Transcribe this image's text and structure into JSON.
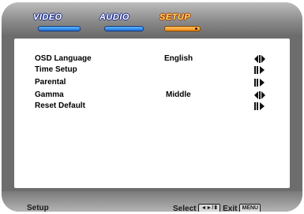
{
  "tabs": [
    {
      "label": "VIDEO",
      "active": false
    },
    {
      "label": "AUDIO",
      "active": false
    },
    {
      "label": "SETUP",
      "active": true
    }
  ],
  "menu": {
    "items": [
      {
        "label": "OSD Language",
        "value": "English",
        "arrow": "left-right-icon"
      },
      {
        "label": "Time Setup",
        "value": "",
        "arrow": "right-icon"
      },
      {
        "label": "Parental",
        "value": "",
        "arrow": "right-icon"
      },
      {
        "label": "Gamma",
        "value": "Middle",
        "arrow": "left-right-icon"
      },
      {
        "label": "Reset Default",
        "value": "",
        "arrow": "right-icon"
      }
    ]
  },
  "footer": {
    "title": "Setup",
    "select_label": "Select",
    "select_key": "◄►/⬍",
    "exit_label": "Exit",
    "exit_key": "MENU"
  },
  "colors": {
    "frame": "#6d6d6d",
    "tab_underline": "#1c6fd8",
    "active_tab_underline": "#f08a10"
  }
}
